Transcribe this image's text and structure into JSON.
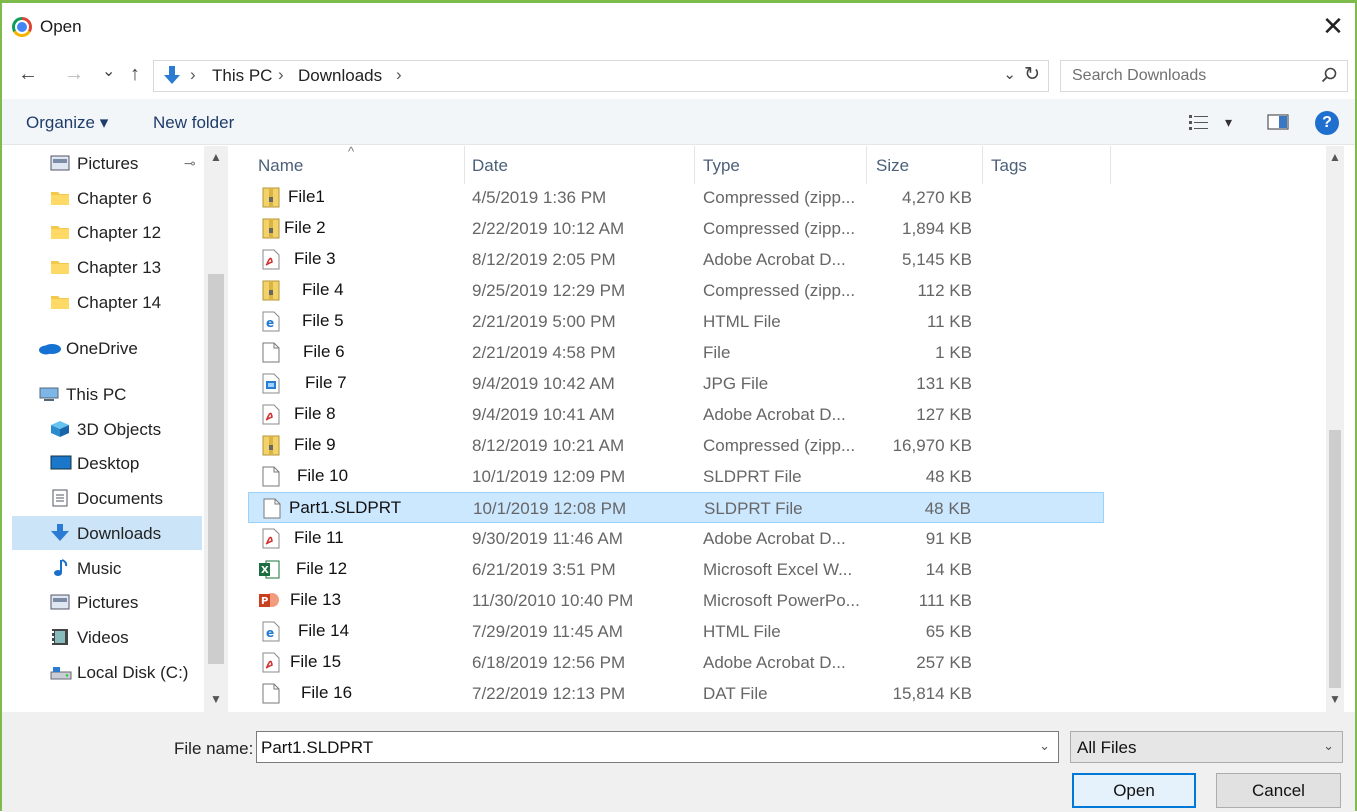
{
  "window": {
    "title": "Open",
    "close_glyph": "✕"
  },
  "nav": {
    "back": "←",
    "forward": "→",
    "recent": "⌄",
    "up": "↑",
    "breadcrumb": [
      "This PC",
      "Downloads"
    ],
    "crumb_sep": "›",
    "dropdown_glyph": "⌄",
    "refresh_glyph": "↻",
    "search_placeholder": "Search Downloads"
  },
  "toolbar": {
    "organize": "Organize ▾",
    "new_folder": "New folder",
    "view_caret": "▾",
    "help": "?"
  },
  "sidebar": {
    "items": [
      {
        "label": "Pictures",
        "icon": "pictures-icon",
        "pinned": true,
        "root": false
      },
      {
        "label": "Chapter 6",
        "icon": "folder-icon",
        "root": false
      },
      {
        "label": "Chapter 12",
        "icon": "folder-icon",
        "root": false
      },
      {
        "label": "Chapter 13",
        "icon": "folder-icon",
        "root": false
      },
      {
        "label": "Chapter 14",
        "icon": "folder-icon",
        "root": false
      },
      {
        "label": "OneDrive",
        "icon": "onedrive-icon",
        "root": true
      },
      {
        "label": "This PC",
        "icon": "this-pc-icon",
        "root": true
      },
      {
        "label": "3D Objects",
        "icon": "3d-objects-icon",
        "root": false
      },
      {
        "label": "Desktop",
        "icon": "desktop-icon",
        "root": false
      },
      {
        "label": "Documents",
        "icon": "documents-icon",
        "root": false
      },
      {
        "label": "Downloads",
        "icon": "downloads-icon",
        "root": false,
        "selected": true
      },
      {
        "label": "Music",
        "icon": "music-icon",
        "root": false
      },
      {
        "label": "Pictures",
        "icon": "pictures-icon",
        "root": false
      },
      {
        "label": "Videos",
        "icon": "videos-icon",
        "root": false
      },
      {
        "label": "Local Disk (C:)",
        "icon": "local-disk-icon",
        "root": false
      }
    ]
  },
  "columns": {
    "name": "Name",
    "date": "Date",
    "type": "Type",
    "size": "Size",
    "tags": "Tags",
    "sort_glyph": "^"
  },
  "files": [
    {
      "name": "File1",
      "date": "4/5/2019 1:36 PM",
      "type": "Compressed (zipp...",
      "size": "4,270 KB",
      "icon": "zip-icon"
    },
    {
      "name": "File 2",
      "date": "2/22/2019 10:12 AM",
      "type": "Compressed (zipp...",
      "size": "1,894 KB",
      "icon": "zip-icon"
    },
    {
      "name": "File 3",
      "date": "8/12/2019 2:05 PM",
      "type": "Adobe Acrobat D...",
      "size": "5,145 KB",
      "icon": "pdf-icon"
    },
    {
      "name": "File 4",
      "date": "9/25/2019 12:29 PM",
      "type": "Compressed (zipp...",
      "size": "112 KB",
      "icon": "zip-icon"
    },
    {
      "name": "File 5",
      "date": "2/21/2019 5:00 PM",
      "type": "HTML File",
      "size": "11 KB",
      "icon": "html-icon"
    },
    {
      "name": "File 6",
      "date": "2/21/2019 4:58 PM",
      "type": "File",
      "size": "1 KB",
      "icon": "blank-file-icon"
    },
    {
      "name": "File 7",
      "date": "9/4/2019 10:42 AM",
      "type": "JPG File",
      "size": "131 KB",
      "icon": "image-file-icon"
    },
    {
      "name": "File 8",
      "date": "9/4/2019 10:41 AM",
      "type": "Adobe Acrobat D...",
      "size": "127 KB",
      "icon": "pdf-icon"
    },
    {
      "name": "File 9",
      "date": "8/12/2019 10:21 AM",
      "type": "Compressed (zipp...",
      "size": "16,970 KB",
      "icon": "zip-icon"
    },
    {
      "name": "File 10",
      "date": "10/1/2019 12:09 PM",
      "type": "SLDPRT File",
      "size": "48 KB",
      "icon": "blank-file-icon"
    },
    {
      "name": "Part1.SLDPRT",
      "date": "10/1/2019 12:08 PM",
      "type": "SLDPRT File",
      "size": "48 KB",
      "icon": "blank-file-icon",
      "selected": true
    },
    {
      "name": "File 11",
      "date": "9/30/2019 11:46 AM",
      "type": "Adobe Acrobat D...",
      "size": "91 KB",
      "icon": "pdf-icon"
    },
    {
      "name": "File 12",
      "date": "6/21/2019 3:51 PM",
      "type": "Microsoft Excel W...",
      "size": "14 KB",
      "icon": "excel-icon"
    },
    {
      "name": "File 13",
      "date": "11/30/2010 10:40 PM",
      "type": "Microsoft PowerPo...",
      "size": "111 KB",
      "icon": "powerpoint-icon"
    },
    {
      "name": "File 14",
      "date": "7/29/2019 11:45 AM",
      "type": "HTML File",
      "size": "65 KB",
      "icon": "html-icon"
    },
    {
      "name": "File 15",
      "date": "6/18/2019 12:56 PM",
      "type": "Adobe Acrobat D...",
      "size": "257 KB",
      "icon": "pdf-icon"
    },
    {
      "name": "File 16",
      "date": "7/22/2019 12:13 PM",
      "type": "DAT File",
      "size": "15,814 KB",
      "icon": "blank-file-icon"
    }
  ],
  "footer": {
    "filename_label": "File name:",
    "filename_value": "Part1.SLDPRT",
    "filetype_value": "All Files",
    "dropdown_glyph": "⌄",
    "open_label": "Open",
    "cancel_label": "Cancel"
  },
  "colors": {
    "accent": "#0078d7",
    "selection": "#cce8ff",
    "frame": "#7dbb4d"
  }
}
